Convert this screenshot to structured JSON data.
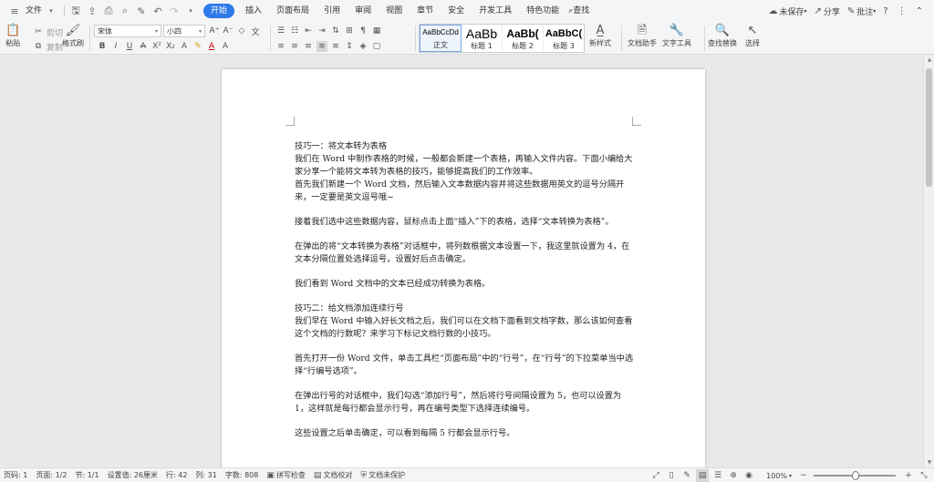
{
  "menubar": {
    "file_label": "文件",
    "tabs": [
      {
        "label": "开始",
        "active": true
      },
      {
        "label": "插入"
      },
      {
        "label": "页面布局"
      },
      {
        "label": "引用"
      },
      {
        "label": "审阅"
      },
      {
        "label": "视图"
      },
      {
        "label": "章节"
      },
      {
        "label": "安全"
      },
      {
        "label": "开发工具"
      },
      {
        "label": "特色功能"
      }
    ],
    "search_label": "查找",
    "right": {
      "unsaved": "未保存",
      "share": "分享",
      "comment": "批注"
    }
  },
  "toolbar": {
    "paste": "粘贴",
    "cut": "剪切",
    "copy": "复制",
    "format_painter": "格式刷",
    "font_name": "宋体",
    "font_size": "小四",
    "styles": [
      {
        "sample": "AaBbCcDd",
        "name": "正文"
      },
      {
        "sample": "AaBb",
        "name": "标题 1"
      },
      {
        "sample": "AaBb(",
        "name": "标题 2"
      },
      {
        "sample": "AaBbC(",
        "name": "标题 3"
      }
    ],
    "new_style": "新样式",
    "doc_assistant": "文档助手",
    "text_tools": "文字工具",
    "find_replace": "查找替换",
    "select": "选择"
  },
  "document": {
    "paragraphs": [
      "技巧一：将文本转为表格",
      "我们在 Word 中制作表格的时候，一般都会新建一个表格，再输入文件内容。下面小编给大家分享一个能将文本转为表格的技巧，能够提高我们的工作效率。",
      "首先我们新建一个 Word 文档，然后输入文本数据内容并将这些数据用英文的逗号分隔开来，一定要是英文逗号哦~",
      "",
      "接着我们选中这些数据内容，鼠标点击上面“插入”下的表格，选择“文本转换为表格”。",
      "",
      "在弹出的将“文本转换为表格”对话框中，将列数根据文本设置一下，我这里就设置为 4，在文本分隔位置处选择逗号，设置好后点击确定。",
      "",
      "我们看到 Word 文档中的文本已经成功转换为表格。",
      "",
      "技巧二：给文档添加连续行号",
      "我们早在 Word 中输入好长文档之后，我们可以在文档下面看到文档字数，那么该如何查看这个文档的行数呢？来学习下标记文档行数的小技巧。",
      "",
      "首先打开一份 Word 文件，单击工具栏“页面布局”中的“行号”，在“行号”的下拉菜单当中选择“行编号选项”。",
      "",
      "在弹出行号的对话框中，我们勾选“添加行号”，然后将行号间隔设置为 5，也可以设置为 1，这样就是每行都会显示行号，再在编号类型下选择连续编号。",
      "",
      "这些设置之后单击确定，可以看到每隔 5 行都会显示行号。"
    ]
  },
  "statusbar": {
    "page_num": "页码: 1",
    "pages": "页面: 1/2",
    "section": "节: 1/1",
    "setting": "设置值: 26厘米",
    "row": "行: 42",
    "col": "列: 31",
    "word_count": "字数: 808",
    "spell_check": "拼写检查",
    "doc_proof": "文档校对",
    "doc_protect": "文档未保护",
    "zoom": "100%"
  }
}
